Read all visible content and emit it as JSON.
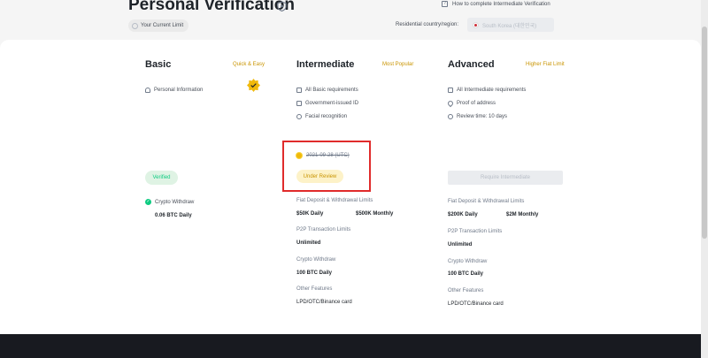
{
  "header": {
    "title": "Personal Verification",
    "current_limit_label": "Your Current Limit",
    "help_link": "How to complete Intermediate Verification",
    "country_label": "Residential country/region:",
    "country_value": "South Korea (대한민국)"
  },
  "levels": {
    "basic": {
      "title": "Basic",
      "tag": "Quick & Easy",
      "requirements": [
        "Personal Information"
      ],
      "status": "Verified",
      "crypto_withdraw_label": "Crypto Withdraw",
      "crypto_withdraw_value": "0.06 BTC Daily"
    },
    "intermediate": {
      "title": "Intermediate",
      "tag": "Most Popular",
      "requirements": [
        "All Basic requirements",
        "Government-issued ID",
        "Facial recognition"
      ],
      "date": "2021-09-28 (UTC)",
      "status": "Under Review",
      "fiat_label": "Fiat Deposit & Withdrawal Limits",
      "fiat_daily": "$50K Daily",
      "fiat_monthly": "$500K Monthly",
      "p2p_label": "P2P Transaction Limits",
      "p2p_value": "Unlimited",
      "crypto_label": "Crypto Withdraw",
      "crypto_value": "100 BTC Daily",
      "features_label": "Other Features",
      "features_value": "LPD/OTC/Binance card"
    },
    "advanced": {
      "title": "Advanced",
      "tag": "Higher Fiat Limit",
      "requirements": [
        "All Intermediate requirements",
        "Proof of address",
        "Review time: 10 days"
      ],
      "button": "Require Intermediate",
      "fiat_label": "Fiat Deposit & Withdrawal Limits",
      "fiat_daily": "$200K Daily",
      "fiat_monthly": "$2M Monthly",
      "p2p_label": "P2P Transaction Limits",
      "p2p_value": "Unlimited",
      "crypto_label": "Crypto Withdraw",
      "crypto_value": "100 BTC Daily",
      "features_label": "Other Features",
      "features_value": "LPD/OTC/Binance card"
    }
  },
  "colors": {
    "accent": "#c99400",
    "brand_yellow": "#f0b90b",
    "success": "#0ecb81",
    "highlight_box": "#e02b2b",
    "footer": "#181a20"
  },
  "icons": {
    "title": "shield-icon",
    "help": "document-icon",
    "basic_badge": "verified-badge-icon",
    "date": "sun-icon"
  }
}
